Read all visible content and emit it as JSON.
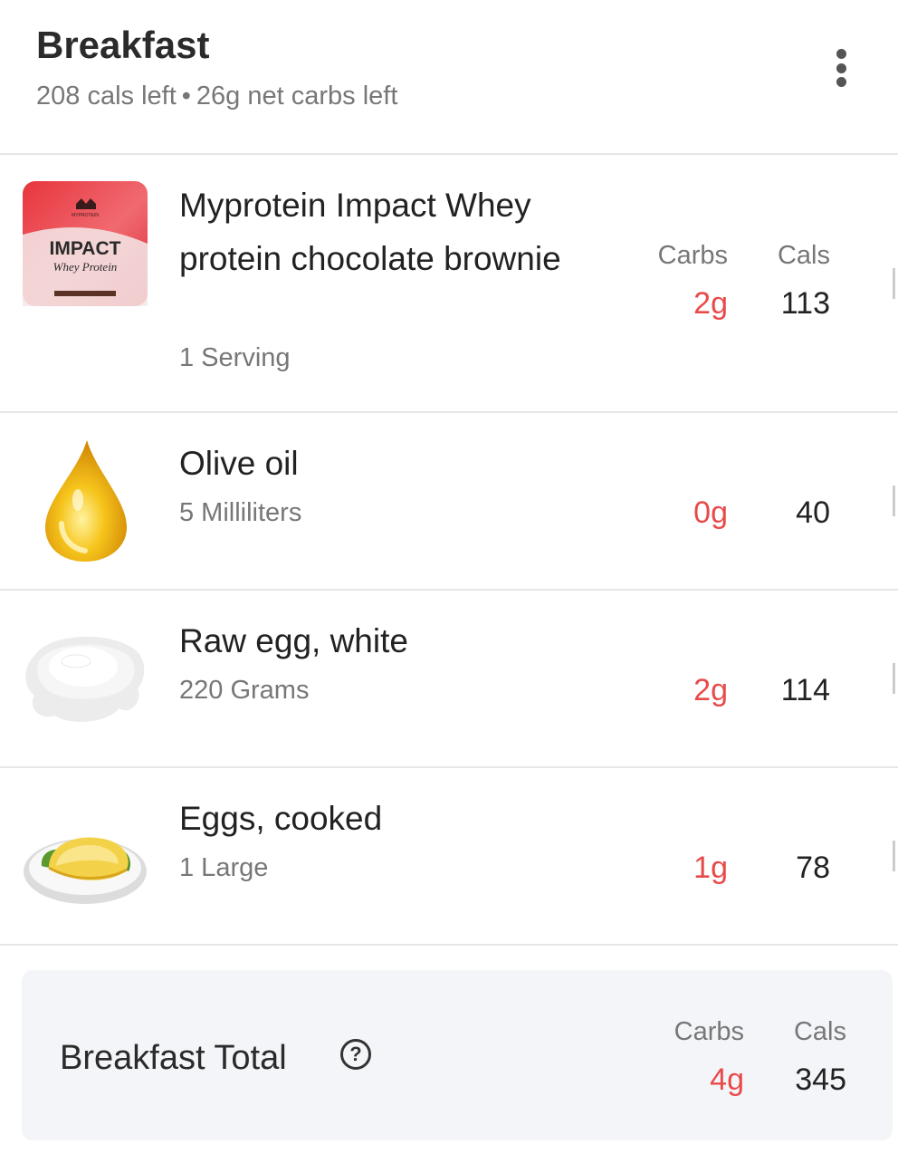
{
  "meal": {
    "title": "Breakfast",
    "cals_left": "208 cals left",
    "separator": "•",
    "carbs_left": "26g net carbs left"
  },
  "columns": {
    "carbs": "Carbs",
    "cals": "Cals"
  },
  "foods": [
    {
      "name": "Myprotein Impact Whey protein chocolate brownie",
      "amount": "1 Serving",
      "carbs": "2g",
      "cals": "113",
      "image": "protein-pouch-image"
    },
    {
      "name": "Olive oil",
      "amount": "5 Milliliters",
      "carbs": "0g",
      "cals": "40",
      "image": "oil-drop-image"
    },
    {
      "name": "Raw egg, white",
      "amount": "220 Grams",
      "carbs": "2g",
      "cals": "114",
      "image": "egg-white-image"
    },
    {
      "name": "Eggs, cooked",
      "amount": "1 Large",
      "carbs": "1g",
      "cals": "78",
      "image": "omelette-image"
    }
  ],
  "total": {
    "label": "Breakfast Total",
    "carbs": "4g",
    "cals": "345",
    "help_glyph": "?"
  },
  "product_label": {
    "brand": "MYPROTEIN",
    "line1": "IMPACT",
    "line2": "Whey Protein"
  },
  "colors": {
    "carbs": "#e84a4a",
    "total_bg": "#f4f5f9"
  }
}
